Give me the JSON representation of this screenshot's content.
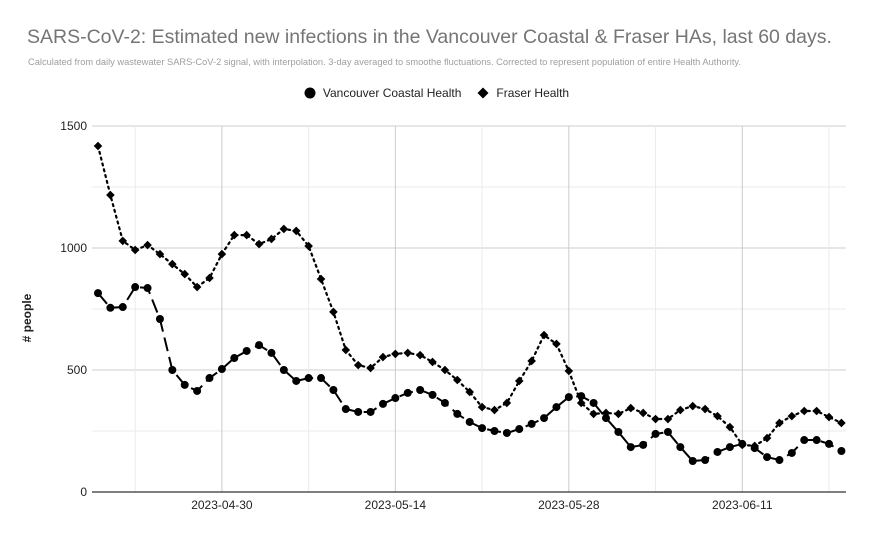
{
  "chart_data": {
    "type": "line",
    "title": "SARS-CoV-2: Estimated new infections in the Vancouver Coastal & Fraser HAs, last 60 days.",
    "subtitle": "Calculated from daily wastewater SARS-CoV-2 signal, with interpolation. 3-day averaged to smoothe fluctuations. Corrected to represent population of entire Health Authority.",
    "xlabel": "",
    "ylabel": "# people",
    "ylim": [
      0,
      1500
    ],
    "yticks": [
      0,
      500,
      1000,
      1500
    ],
    "xlim": [
      "2023-04-20",
      "2023-06-19"
    ],
    "xticks": [
      "2023-04-30",
      "2023-05-14",
      "2023-05-28",
      "2023-06-11"
    ],
    "grid": true,
    "legend_position": "top",
    "x_start_date": "2023-04-20",
    "x_step_days": 1,
    "series": [
      {
        "name": "Vancouver Coastal Health",
        "marker": "circle",
        "line_style": "dashed",
        "color": "#000000",
        "values": [
          815,
          755,
          758,
          840,
          836,
          709,
          500,
          439,
          414,
          467,
          504,
          549,
          578,
          602,
          570,
          500,
          455,
          467,
          467,
          418,
          340,
          328,
          328,
          361,
          385,
          406,
          418,
          398,
          365,
          320,
          287,
          262,
          250,
          242,
          258,
          279,
          303,
          348,
          389,
          393,
          365,
          303,
          246,
          184,
          193,
          238,
          246,
          184,
          127,
          131,
          164,
          184,
          197,
          180,
          143,
          131,
          160,
          213,
          213,
          197,
          168
        ]
      },
      {
        "name": "Fraser Health",
        "marker": "diamond",
        "line_style": "dotted",
        "color": "#000000",
        "values": [
          1418,
          1217,
          1029,
          992,
          1012,
          975,
          934,
          893,
          840,
          877,
          975,
          1053,
          1053,
          1016,
          1037,
          1078,
          1070,
          1008,
          873,
          738,
          582,
          520,
          508,
          553,
          566,
          570,
          561,
          533,
          500,
          459,
          410,
          348,
          336,
          365,
          455,
          537,
          643,
          607,
          496,
          365,
          320,
          324,
          320,
          344,
          324,
          299,
          299,
          336,
          352,
          340,
          311,
          266,
          193,
          189,
          221,
          283,
          311,
          332,
          332,
          307,
          283
        ]
      }
    ]
  }
}
